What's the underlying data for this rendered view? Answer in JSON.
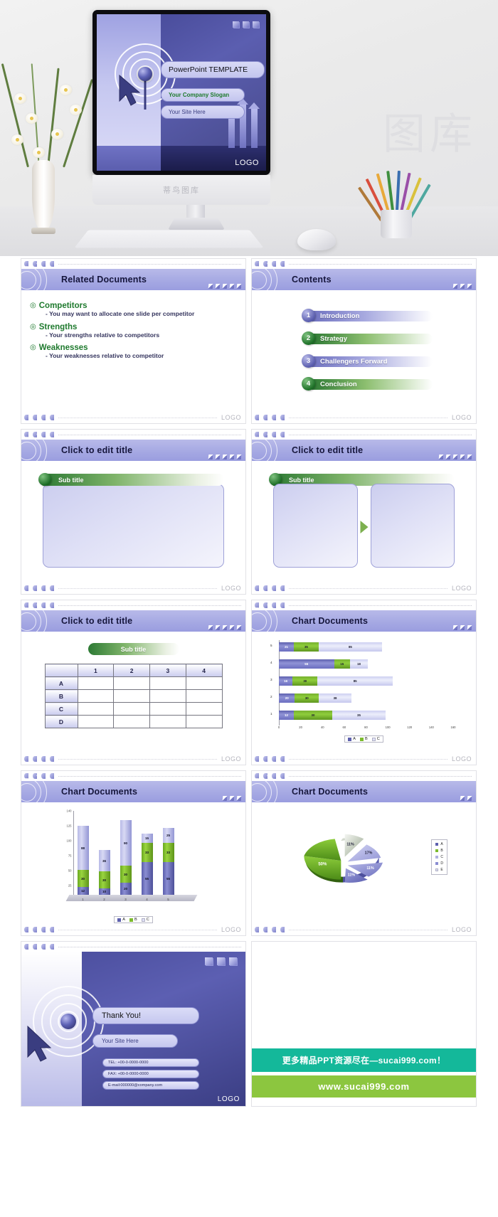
{
  "hero": {
    "screen": {
      "title_field": "PowerPoint TEMPLATE",
      "slogan_field": "Your Company Slogan",
      "site_field": "Your Site Here",
      "logo": "LOGO"
    },
    "monitor_watermark": "蒂鸟图库"
  },
  "slides": [
    {
      "id": "related-documents",
      "title": "Related Documents",
      "footer_logo": "LOGO",
      "bullets": [
        {
          "head": "Competitors",
          "sub": "- You may want to allocate one slide per competitor"
        },
        {
          "head": "Strengths",
          "sub": "- Your strengths relative to competitors"
        },
        {
          "head": "Weaknesses",
          "sub": "- Your weaknesses relative to competitor"
        }
      ]
    },
    {
      "id": "contents",
      "title": "Contents",
      "footer_logo": "LOGO",
      "items": [
        {
          "num": "1",
          "label": "Introduction",
          "color": "purple"
        },
        {
          "num": "2",
          "label": "Strategy",
          "color": "green"
        },
        {
          "num": "3",
          "label": "Challengers Forward",
          "color": "purple"
        },
        {
          "num": "4",
          "label": "Conclusion",
          "color": "green"
        }
      ]
    },
    {
      "id": "edit-title-single-box",
      "title": "Click to edit title",
      "subtitle": "Sub title",
      "footer_logo": "LOGO"
    },
    {
      "id": "edit-title-two-box",
      "title": "Click to edit title",
      "subtitle": "Sub title",
      "footer_logo": "LOGO"
    },
    {
      "id": "edit-title-table",
      "title": "Click to edit title",
      "subtitle": "Sub title",
      "footer_logo": "LOGO",
      "table": {
        "columns": [
          "",
          "1",
          "2",
          "3",
          "4"
        ],
        "rows": [
          "A",
          "B",
          "C",
          "D"
        ]
      }
    },
    {
      "id": "chart-documents-hbar",
      "title": "Chart Documents",
      "footer_logo": "LOGO"
    },
    {
      "id": "chart-documents-column",
      "title": "Chart Documents",
      "footer_logo": "LOGO"
    },
    {
      "id": "chart-documents-pie",
      "title": "Chart Documents",
      "footer_logo": "LOGO"
    }
  ],
  "thank_you": {
    "thanks": "Thank You!",
    "site": "Your Site Here",
    "tel": "TEL: +00-0-0000-0000",
    "fax": "FAX: +00-0-0000-0000",
    "email": "E-mail:000000@company.com",
    "logo": "LOGO"
  },
  "promo": {
    "line1": "更多精品PPT资源尽在—sucai999.com！",
    "line2": "www.sucai999.com"
  },
  "colors": {
    "header_purple": "#a6a9e3",
    "series_a": "#5d60ae",
    "series_b": "#7cbb2e",
    "series_c": "#dfe0f6",
    "green_accent": "#1f7a2e",
    "teal": "#14b89a",
    "lime": "#8cc63f"
  },
  "chart_data": [
    {
      "type": "bar",
      "orientation": "horizontal",
      "title": "Chart Documents",
      "categories": [
        "1",
        "2",
        "3",
        "4",
        "5"
      ],
      "series": [
        {
          "name": "A",
          "values": [
            12,
            20,
            16,
            55,
            21
          ]
        },
        {
          "name": "B",
          "values": [
            30,
            30,
            30,
            15,
            35
          ]
        },
        {
          "name": "C",
          "values": [
            35,
            38,
            85,
            18,
            85
          ]
        }
      ],
      "xlabel": "",
      "ylabel": "",
      "xlim": [
        0,
        160
      ],
      "xticks": [
        0,
        20,
        40,
        60,
        80,
        100,
        120,
        140,
        160
      ],
      "legend": [
        "A",
        "B",
        "C"
      ],
      "legend_position": "bottom",
      "grid": false,
      "stacked": true
    },
    {
      "type": "bar",
      "orientation": "vertical",
      "title": "Chart Documents",
      "categories": [
        "1",
        "2",
        "3",
        "4",
        "5"
      ],
      "series": [
        {
          "name": "A",
          "values": [
            12,
            10,
            20,
            55,
            55
          ]
        },
        {
          "name": "B",
          "values": [
            30,
            30,
            30,
            33,
            33
          ]
        },
        {
          "name": "C",
          "values": [
            88,
            36,
            90,
            15,
            25
          ]
        }
      ],
      "ylim": [
        0,
        140
      ],
      "yticks": [
        0,
        25,
        50,
        75,
        100,
        125,
        140
      ],
      "legend": [
        "A",
        "B",
        "C"
      ],
      "legend_position": "bottom",
      "grid": false,
      "stacked": true
    },
    {
      "type": "pie",
      "title": "Chart Documents",
      "labels": [
        "A",
        "B",
        "C",
        "D",
        "E"
      ],
      "values": [
        50,
        11,
        17,
        11,
        11
      ],
      "value_labels": [
        "50%",
        "11%",
        "17%",
        "11%",
        "11%"
      ],
      "legend": [
        "A",
        "B",
        "C",
        "D",
        "E"
      ],
      "legend_position": "right",
      "exploded": true
    }
  ]
}
